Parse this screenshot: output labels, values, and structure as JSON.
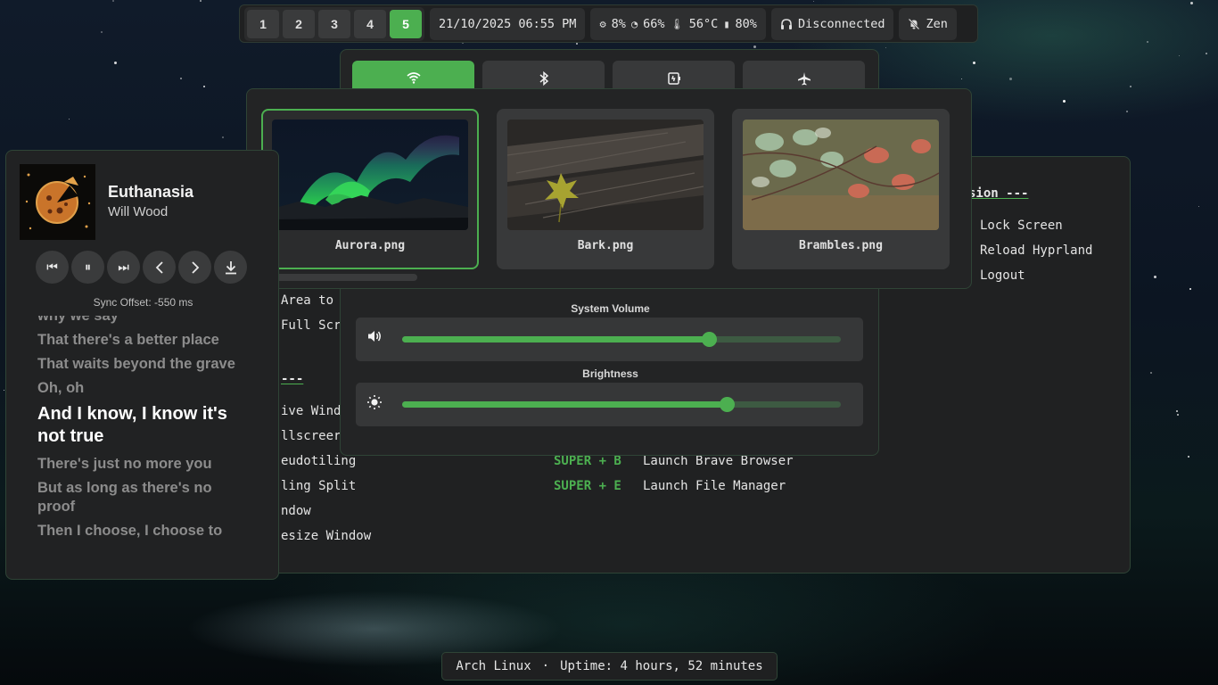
{
  "topbar": {
    "workspaces": [
      "1",
      "2",
      "3",
      "4",
      "5"
    ],
    "active_workspace": "5",
    "datetime": "21/10/2025 06:55 PM",
    "stats": {
      "cpu": "8%",
      "memory": "66%",
      "temp": "56°C",
      "battery": "80%"
    },
    "audio_status": "Disconnected",
    "notifications_mode": "Zen"
  },
  "network": {
    "tabs": [
      "wifi-icon",
      "bluetooth-icon",
      "vpn-icon",
      "airplane-icon"
    ],
    "active_tab": "wifi-icon",
    "volume_label": "System Volume",
    "volume_level": 0.7,
    "brightness_label": "Brightness",
    "brightness_level": 0.74
  },
  "wallpapers": {
    "items": [
      {
        "name": "Aurora.png",
        "selected": true
      },
      {
        "name": "Bark.png",
        "selected": false
      },
      {
        "name": "Brambles.png",
        "selected": false
      }
    ]
  },
  "keybinds": {
    "session_header": "sion ---",
    "session_items": [
      "Lock Screen",
      "Reload Hyprland",
      "Logout"
    ],
    "left_fragments": [
      "Area to",
      "Full Scr",
      "---",
      "ive Wind",
      "llscreer",
      "eudotiling",
      "ling Split",
      "ndow",
      "esize Window"
    ],
    "launch_binds": [
      {
        "key": "SUPER + B",
        "action": "Launch Brave Browser"
      },
      {
        "key": "SUPER + E",
        "action": "Launch File Manager"
      }
    ]
  },
  "player": {
    "title": "Euthanasia",
    "artist": "Will Wood",
    "sync_offset": "Sync Offset: -550 ms",
    "lyrics": [
      {
        "text": "why we say",
        "current": false
      },
      {
        "text": "That there's a better place",
        "current": false
      },
      {
        "text": "That waits beyond the grave",
        "current": false
      },
      {
        "text": "Oh, oh",
        "current": false
      },
      {
        "text": "And I know, I know it's not true",
        "current": true
      },
      {
        "text": "There's just no more you",
        "current": false
      },
      {
        "text": "But as long as there's no proof",
        "current": false
      },
      {
        "text": "Then I choose, I choose to",
        "current": false
      }
    ]
  },
  "status": {
    "os": "Arch Linux",
    "separator": "·",
    "uptime": "Uptime: 4 hours, 52 minutes"
  },
  "colors": {
    "accent": "#4caf50",
    "panel": "#232425",
    "panel_border": "#2f4436"
  }
}
